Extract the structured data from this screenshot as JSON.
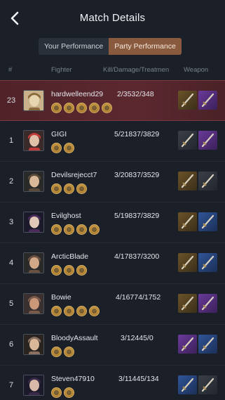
{
  "header": {
    "title": "Match Details"
  },
  "tabs": [
    {
      "label": "Your Performance",
      "active": false
    },
    {
      "label": "Party Performance",
      "active": true
    }
  ],
  "columns": {
    "rank": "#",
    "fighter": "Fighter",
    "stats": "Kill/Damage/Treatmen",
    "weapon": "Weapon"
  },
  "colors": {
    "accent": "#8a5a3e",
    "highlight_row": "#5c2830",
    "badge_gold": "#d8b46b"
  },
  "players": [
    {
      "rank": "23",
      "name": "hardwelleend29",
      "stats": "2/3532/348",
      "badges": 5,
      "weapons": [
        "gauntlet-icon",
        "sword-icon"
      ],
      "weapon_tiers": [
        "gold",
        "purple"
      ],
      "avatar": "avatar-1",
      "highlight": true
    },
    {
      "rank": "1",
      "name": "GIGI",
      "stats": "5/21837/3829",
      "badges": 2,
      "weapons": [
        "nunchaku-icon",
        "spear-icon"
      ],
      "weapon_tiers": [
        "dark",
        "purple"
      ],
      "avatar": "avatar-2",
      "highlight": false
    },
    {
      "rank": "2",
      "name": "Devilsrejecct7",
      "stats": "3/20837/3529",
      "badges": 3,
      "weapons": [
        "dagger-icon",
        "crossbow-icon"
      ],
      "weapon_tiers": [
        "gold",
        "dark"
      ],
      "avatar": "avatar-3",
      "highlight": false
    },
    {
      "rank": "3",
      "name": "Evilghost",
      "stats": "5/19837/3829",
      "badges": 4,
      "weapons": [
        "sword-icon",
        "spear-icon"
      ],
      "weapon_tiers": [
        "gold",
        "blue"
      ],
      "avatar": "avatar-4",
      "highlight": false
    },
    {
      "rank": "4",
      "name": "ArcticBlade",
      "stats": "4/17837/3200",
      "badges": 3,
      "weapons": [
        "sword-icon",
        "spear-icon"
      ],
      "weapon_tiers": [
        "gold",
        "blue"
      ],
      "avatar": "avatar-5",
      "highlight": false
    },
    {
      "rank": "5",
      "name": "Bowie",
      "stats": "4/16774/1752",
      "badges": 4,
      "weapons": [
        "cannon-icon",
        "sword-icon"
      ],
      "weapon_tiers": [
        "gold",
        "purple"
      ],
      "avatar": "avatar-6",
      "highlight": false
    },
    {
      "rank": "6",
      "name": "BloodyAssault",
      "stats": "3/12445/0",
      "badges": 2,
      "weapons": [
        "sword-icon",
        "spear-icon"
      ],
      "weapon_tiers": [
        "purple",
        "blue"
      ],
      "avatar": "avatar-7",
      "highlight": false
    },
    {
      "rank": "7",
      "name": "Steven47910",
      "stats": "3/11445/134",
      "badges": 2,
      "weapons": [
        "spear-icon",
        "crossbow-icon"
      ],
      "weapon_tiers": [
        "blue",
        "dark"
      ],
      "avatar": "avatar-8",
      "highlight": false
    }
  ]
}
